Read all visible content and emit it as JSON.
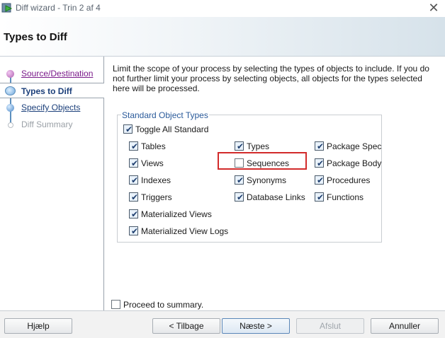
{
  "window": {
    "title": "Diff wizard - Trin 2 af 4"
  },
  "header": {
    "title": "Types to Diff"
  },
  "sidebar": {
    "steps": [
      {
        "label": "Source/Destination",
        "state": "done"
      },
      {
        "label": "Types to Diff",
        "state": "current"
      },
      {
        "label": "Specify Objects",
        "state": "next"
      },
      {
        "label": "Diff Summary",
        "state": "disabled"
      }
    ]
  },
  "main": {
    "description": "Limit the scope of your process by selecting the types of objects to include.  If you do not further limit your process by selecting objects, all objects for the types selected here will be processed.",
    "group_title": "Standard Object Types",
    "toggle_all": {
      "label": "Toggle All Standard",
      "checked": true
    },
    "types": [
      {
        "label": "Tables",
        "checked": true
      },
      {
        "label": "Views",
        "checked": true
      },
      {
        "label": "Indexes",
        "checked": true
      },
      {
        "label": "Triggers",
        "checked": true
      },
      {
        "label": "Materialized Views",
        "checked": true
      },
      {
        "label": "Materialized View Logs",
        "checked": true
      },
      {
        "label": "Types",
        "checked": true
      },
      {
        "label": "Sequences",
        "checked": false
      },
      {
        "label": "Synonyms",
        "checked": true
      },
      {
        "label": "Database Links",
        "checked": true
      },
      {
        "label": "Package Spec",
        "checked": true
      },
      {
        "label": "Package Body",
        "checked": true
      },
      {
        "label": "Procedures",
        "checked": true
      },
      {
        "label": "Functions",
        "checked": true
      }
    ],
    "proceed": {
      "label": "Proceed to summary.",
      "checked": false
    }
  },
  "footer": {
    "help": "Hjælp",
    "back": "< Tilbage",
    "next": "Næste >",
    "finish": "Afslut",
    "cancel": "Annuller"
  },
  "colors": {
    "highlight": "#d22b2b",
    "accent": "#2a5a9a"
  }
}
